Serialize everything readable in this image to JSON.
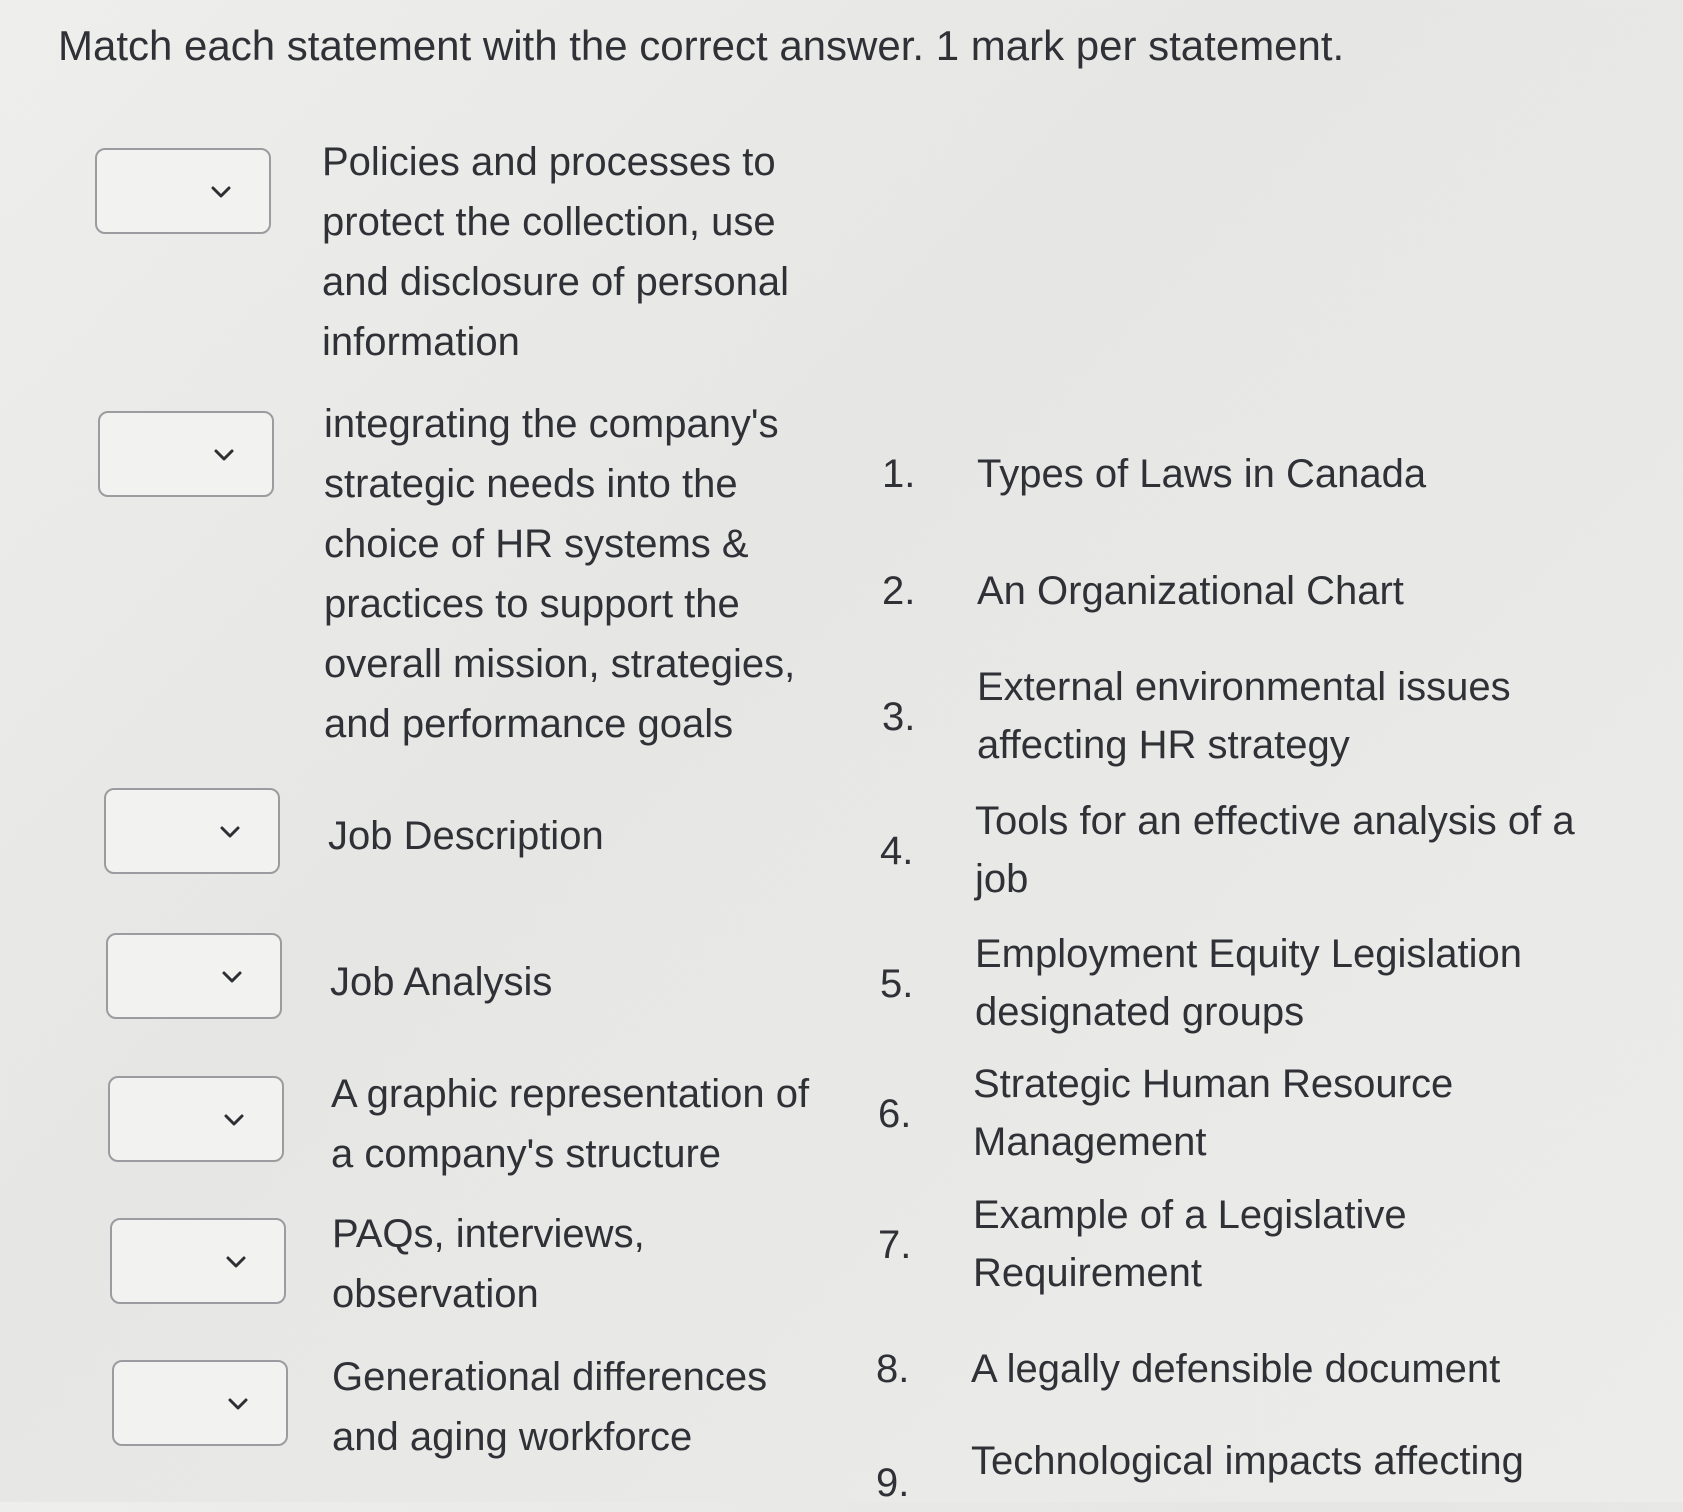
{
  "title": "Match each statement with the correct answer. 1 mark per statement.",
  "statements": [
    {
      "text": "Policies and processes to protect the collection, use and disclosure of personal information",
      "selected": ""
    },
    {
      "text": "integrating the company's strategic needs into the choice of HR systems & practices to support the overall mission, strategies, and performance goals",
      "selected": ""
    },
    {
      "text": "Job Description",
      "selected": ""
    },
    {
      "text": "Job Analysis",
      "selected": ""
    },
    {
      "text": "A graphic representation of a company's structure",
      "selected": ""
    },
    {
      "text": "PAQs, interviews, observation",
      "selected": ""
    },
    {
      "text": "Generational differences and aging workforce",
      "selected": ""
    }
  ],
  "answers": [
    {
      "num": "1.",
      "text": "Types of Laws in Canada"
    },
    {
      "num": "2.",
      "text": "An Organizational Chart"
    },
    {
      "num": "3.",
      "text": "External environmental issues affecting HR strategy"
    },
    {
      "num": "4.",
      "text": "Tools for an effective analysis of a job"
    },
    {
      "num": "5.",
      "text": "Employment Equity Legislation designated groups"
    },
    {
      "num": "6.",
      "text": "Strategic Human Resource Management"
    },
    {
      "num": "7.",
      "text": "Example of a Legislative Requirement"
    },
    {
      "num": "8.",
      "text": "A legally defensible document"
    },
    {
      "num": "9.",
      "text": "Technological impacts affecting"
    }
  ],
  "icons": {
    "dropdown": "chevron-down-icon"
  }
}
